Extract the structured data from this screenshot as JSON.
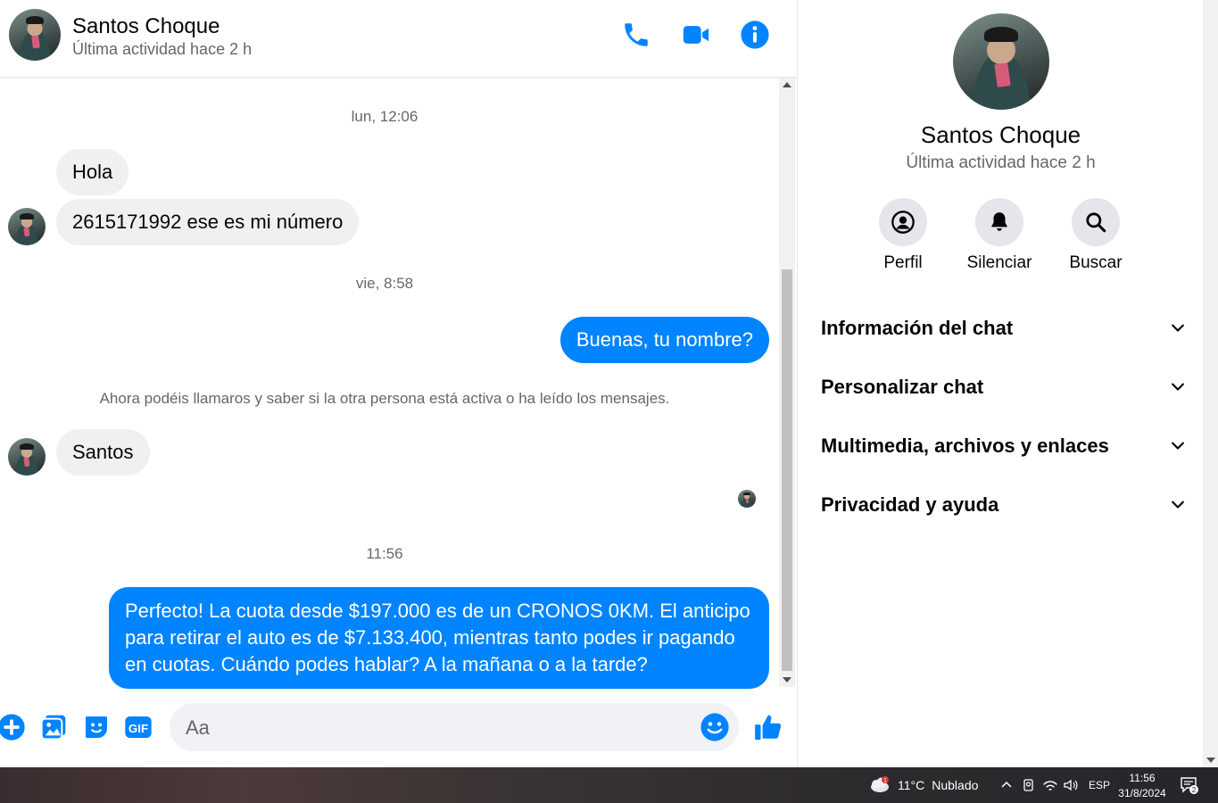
{
  "header": {
    "name": "Santos Choque",
    "status": "Última actividad hace 2 h",
    "icons": [
      "phone-icon",
      "video-camera-icon",
      "info-icon"
    ]
  },
  "conversation": {
    "timestamp_1": "lun, 12:06",
    "msg_hola": "Hola",
    "msg_numero": "2615171992 ese es mi número",
    "timestamp_2": "vie, 8:58",
    "msg_out_nombre": "Buenas, tu nombre?",
    "system_note": "Ahora podéis llamaros y saber si la otra persona está activa o ha leído los mensajes.",
    "msg_santos": "Santos",
    "timestamp_3": "11:56",
    "msg_out_long": "Perfecto! La cuota desde $197.000 es de un CRONOS 0KM. El anticipo para retirar el auto es de $7.133.400, mientras tanto podes ir pagando en cuotas. Cuándo podes hablar? A la mañana o a la tarde?"
  },
  "composer": {
    "placeholder": "Aa",
    "icons": [
      "plus-icon",
      "image-icon",
      "sticker-icon",
      "gif-icon",
      "emoji-icon",
      "like-icon"
    ]
  },
  "side_panel": {
    "name": "Santos Choque",
    "status": "Última actividad hace 2 h",
    "actions": [
      {
        "label": "Perfil",
        "icon": "profile-icon"
      },
      {
        "label": "Silenciar",
        "icon": "bell-icon"
      },
      {
        "label": "Buscar",
        "icon": "search-icon"
      }
    ],
    "sections": [
      "Información del chat",
      "Personalizar chat",
      "Multimedia, archivos y enlaces",
      "Privacidad y ayuda"
    ]
  },
  "taskbar": {
    "temperature": "11°C",
    "weather": "Nublado",
    "weather_badge": "1",
    "language": "ESP",
    "time": "11:56",
    "date": "31/8/2024",
    "notification_count": "2"
  },
  "colors": {
    "accent": "#0084ff",
    "incoming_bubble": "#f0f0f0",
    "secondary_text": "#65676b",
    "action_circle": "#e4e6eb"
  }
}
